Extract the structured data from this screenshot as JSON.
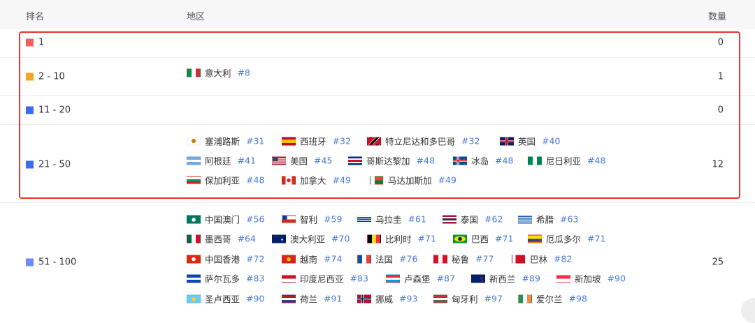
{
  "header": {
    "rank_label": "排名",
    "region_label": "地区",
    "count_label": "数量"
  },
  "rows": [
    {
      "rank": "1",
      "count": "0",
      "color": "#f06262"
    },
    {
      "rank": "2 - 10",
      "count": "1",
      "color": "#f5a623"
    },
    {
      "rank": "11 - 20",
      "count": "0",
      "color": "#3d6bf0"
    },
    {
      "rank": "21 - 50",
      "count": "12",
      "color": "#3d6bf0"
    },
    {
      "rank": "51 - 100",
      "count": "25",
      "color": "#6d8cf5"
    }
  ],
  "countries": [
    {
      "name": "意大利",
      "num": "#8",
      "flag": "it"
    },
    {
      "name": "塞浦路斯",
      "num": "#31",
      "flag": "cy"
    },
    {
      "name": "西班牙",
      "num": "#32",
      "flag": "es"
    },
    {
      "name": "特立尼达和多巴哥",
      "num": "#32",
      "flag": "tt"
    },
    {
      "name": "英国",
      "num": "#40",
      "flag": "gb"
    },
    {
      "name": "阿根廷",
      "num": "#41",
      "flag": "ar"
    },
    {
      "name": "美国",
      "num": "#45",
      "flag": "us"
    },
    {
      "name": "哥斯达黎加",
      "num": "#48",
      "flag": "cr"
    },
    {
      "name": "冰岛",
      "num": "#48",
      "flag": "is"
    },
    {
      "name": "尼日利亚",
      "num": "#48",
      "flag": "ng"
    },
    {
      "name": "保加利亚",
      "num": "#48",
      "flag": "bg"
    },
    {
      "name": "加拿大",
      "num": "#49",
      "flag": "ca"
    },
    {
      "name": "马达加斯加",
      "num": "#49",
      "flag": "mg"
    },
    {
      "name": "中国澳门",
      "num": "#56",
      "flag": "mo"
    },
    {
      "name": "智利",
      "num": "#59",
      "flag": "cl"
    },
    {
      "name": "乌拉圭",
      "num": "#61",
      "flag": "uy"
    },
    {
      "name": "泰国",
      "num": "#62",
      "flag": "th"
    },
    {
      "name": "希腊",
      "num": "#63",
      "flag": "gr"
    },
    {
      "name": "墨西哥",
      "num": "#64",
      "flag": "mx"
    },
    {
      "name": "澳大利亚",
      "num": "#70",
      "flag": "au"
    },
    {
      "name": "比利时",
      "num": "#71",
      "flag": "be"
    },
    {
      "name": "巴西",
      "num": "#71",
      "flag": "br"
    },
    {
      "name": "厄瓜多尔",
      "num": "#71",
      "flag": "ec"
    },
    {
      "name": "中国香港",
      "num": "#72",
      "flag": "hk"
    },
    {
      "name": "越南",
      "num": "#74",
      "flag": "vn"
    },
    {
      "name": "法国",
      "num": "#76",
      "flag": "fr"
    },
    {
      "name": "秘鲁",
      "num": "#77",
      "flag": "pe"
    },
    {
      "name": "巴林",
      "num": "#82",
      "flag": "bh"
    },
    {
      "name": "萨尔瓦多",
      "num": "#83",
      "flag": "sv"
    },
    {
      "name": "印度尼西亚",
      "num": "#83",
      "flag": "id"
    },
    {
      "name": "卢森堡",
      "num": "#87",
      "flag": "lu"
    },
    {
      "name": "新西兰",
      "num": "#89",
      "flag": "nz"
    },
    {
      "name": "新加坡",
      "num": "#90",
      "flag": "sg"
    },
    {
      "name": "圣卢西亚",
      "num": "#90",
      "flag": "lc"
    },
    {
      "name": "荷兰",
      "num": "#91",
      "flag": "nl"
    },
    {
      "name": "挪威",
      "num": "#93",
      "flag": "no"
    },
    {
      "name": "匈牙利",
      "num": "#97",
      "flag": "hu"
    },
    {
      "name": "爱尔兰",
      "num": "#98",
      "flag": "ie"
    }
  ]
}
